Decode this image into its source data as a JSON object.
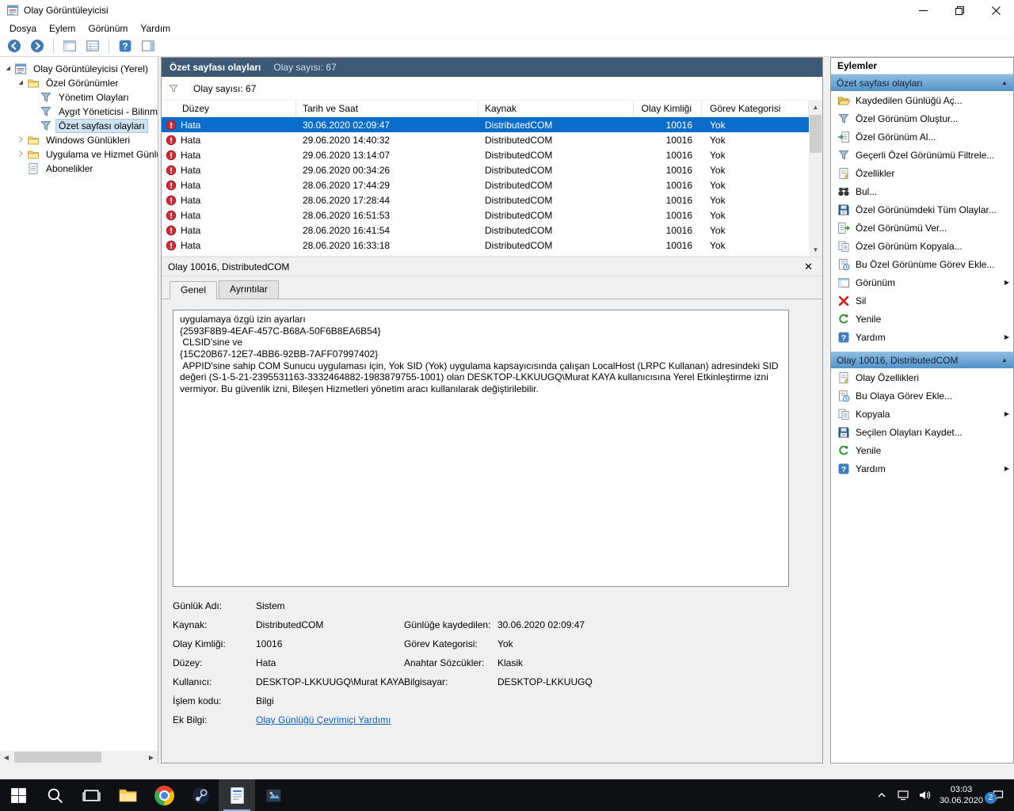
{
  "window": {
    "title": "Olay Görüntüleyicisi",
    "menu_items": [
      "Dosya",
      "Eylem",
      "Görünüm",
      "Yardım"
    ]
  },
  "toolbar": {
    "icons": [
      "back",
      "forward",
      "sep",
      "console-tree",
      "list-view",
      "sep",
      "help",
      "action-pane"
    ]
  },
  "tree": {
    "items": [
      {
        "label": "Olay Görüntüleyicisi (Yerel)",
        "level": 0,
        "icon": "app",
        "expander": "expanded",
        "selected": false
      },
      {
        "label": "Özel Görünümler",
        "level": 1,
        "icon": "folder",
        "expander": "expanded",
        "selected": false
      },
      {
        "label": "Yönetim Olayları",
        "level": 2,
        "icon": "filter",
        "expander": "none",
        "selected": false
      },
      {
        "label": "Aygıt Yöneticisi - Bilinme",
        "level": 2,
        "icon": "filter",
        "expander": "none",
        "selected": false
      },
      {
        "label": "Özet sayfası olayları",
        "level": 2,
        "icon": "filter",
        "expander": "none",
        "selected": true
      },
      {
        "label": "Windows Günlükleri",
        "level": 1,
        "icon": "folder",
        "expander": "collapsed",
        "selected": false
      },
      {
        "label": "Uygulama ve Hizmet Günlük",
        "level": 1,
        "icon": "folder",
        "expander": "collapsed",
        "selected": false
      },
      {
        "label": "Abonelikler",
        "level": 1,
        "icon": "doc",
        "expander": "none",
        "selected": false
      }
    ]
  },
  "main": {
    "header_title": "Özet sayfası olayları",
    "header_count": "Olay sayısı: 67",
    "filter_count": "Olay sayısı: 67",
    "table": {
      "columns": [
        "Düzey",
        "Tarih ve Saat",
        "Kaynak",
        "Olay Kimliği",
        "Görev Kategorisi"
      ],
      "rows": [
        {
          "level": "Hata",
          "datetime": "30.06.2020 02:09:47",
          "source": "DistributedCOM",
          "event_id": "10016",
          "category": "Yok",
          "selected": true
        },
        {
          "level": "Hata",
          "datetime": "29.06.2020 14:40:32",
          "source": "DistributedCOM",
          "event_id": "10016",
          "category": "Yok",
          "selected": false
        },
        {
          "level": "Hata",
          "datetime": "29.06.2020 13:14:07",
          "source": "DistributedCOM",
          "event_id": "10016",
          "category": "Yok",
          "selected": false
        },
        {
          "level": "Hata",
          "datetime": "29.06.2020 00:34:26",
          "source": "DistributedCOM",
          "event_id": "10016",
          "category": "Yok",
          "selected": false
        },
        {
          "level": "Hata",
          "datetime": "28.06.2020 17:44:29",
          "source": "DistributedCOM",
          "event_id": "10016",
          "category": "Yok",
          "selected": false
        },
        {
          "level": "Hata",
          "datetime": "28.06.2020 17:28:44",
          "source": "DistributedCOM",
          "event_id": "10016",
          "category": "Yok",
          "selected": false
        },
        {
          "level": "Hata",
          "datetime": "28.06.2020 16:51:53",
          "source": "DistributedCOM",
          "event_id": "10016",
          "category": "Yok",
          "selected": false
        },
        {
          "level": "Hata",
          "datetime": "28.06.2020 16:41:54",
          "source": "DistributedCOM",
          "event_id": "10016",
          "category": "Yok",
          "selected": false
        },
        {
          "level": "Hata",
          "datetime": "28.06.2020 16:33:18",
          "source": "DistributedCOM",
          "event_id": "10016",
          "category": "Yok",
          "selected": false
        }
      ]
    }
  },
  "detail": {
    "title": "Olay 10016, DistributedCOM",
    "tabs": [
      "Genel",
      "Ayrıntılar"
    ],
    "active_tab": "Genel",
    "description": "uygulamaya özgü izin ayarları\n{2593F8B9-4EAF-457C-B68A-50F6B8EA6B54}\n CLSID'sine ve\n{15C20B67-12E7-4BB6-92BB-7AFF07997402}\n APPID'sine sahip COM Sunucu uygulaması için, Yok SID (Yok) uygulama kapsayıcısında çalışan LocalHost (LRPC Kullanan) adresindeki SID değeri (S-1-5-21-2395531163-3332464882-1983879755-1001) olan DESKTOP-LKKUUGQ\\Murat KAYA kullanıcısına Yerel Etkinleştirme izni vermiyor. Bu güvenlik izni, Bileşen Hizmetleri yönetim aracı kullanılarak değiştirilebilir.",
    "fields": [
      {
        "label": "Günlük Adı:",
        "value": "Sistem",
        "label2": "",
        "value2": "",
        "link": false
      },
      {
        "label": "Kaynak:",
        "value": "DistributedCOM",
        "label2": "Günlüğe kaydedilen:",
        "value2": "30.06.2020 02:09:47",
        "link": false
      },
      {
        "label": "Olay Kimliği:",
        "value": "10016",
        "label2": "Görev Kategorisi:",
        "value2": "Yok",
        "link": false
      },
      {
        "label": "Düzey:",
        "value": "Hata",
        "label2": "Anahtar Sözcükler:",
        "value2": "Klasik",
        "link": false
      },
      {
        "label": "Kullanıcı:",
        "value": "DESKTOP-LKKUUGQ\\Murat KAYA",
        "label2": "Bilgisayar:",
        "value2": "DESKTOP-LKKUUGQ",
        "link": false
      },
      {
        "label": "İşlem kodu:",
        "value": "Bilgi",
        "label2": "",
        "value2": "",
        "link": false
      },
      {
        "label": "Ek Bilgi:",
        "value": "Olay Günlüğü Çevrimiçi Yardımı",
        "label2": "",
        "value2": "",
        "link": true
      }
    ]
  },
  "actions": {
    "title": "Eylemler",
    "groups": [
      {
        "header": "Özet sayfası olayları",
        "items": [
          {
            "label": "Kaydedilen Günlüğü Aç...",
            "icon": "folder-open",
            "submenu": false
          },
          {
            "label": "Özel Görünüm Oluştur...",
            "icon": "filter",
            "submenu": false
          },
          {
            "label": "Özel Görünüm Al...",
            "icon": "import",
            "submenu": false
          },
          {
            "label": "Geçerli Özel Görünümü Filtrele...",
            "icon": "filter",
            "submenu": false
          },
          {
            "label": "Özellikler",
            "icon": "props",
            "submenu": false
          },
          {
            "label": "Bul...",
            "icon": "find",
            "submenu": false
          },
          {
            "label": "Özel Görünümdeki Tüm Olaylar...",
            "icon": "save",
            "submenu": false
          },
          {
            "label": "Özel Görünümü Ver...",
            "icon": "export",
            "submenu": false
          },
          {
            "label": "Özel Görünüm Kopyala...",
            "icon": "copy",
            "submenu": false
          },
          {
            "label": "Bu Özel Görünüme Görev Ekle...",
            "icon": "task",
            "submenu": false
          },
          {
            "label": "Görünüm",
            "icon": "view",
            "submenu": true
          },
          {
            "label": "Sil",
            "icon": "del",
            "submenu": false
          },
          {
            "label": "Yenile",
            "icon": "refresh",
            "submenu": false
          },
          {
            "label": "Yardım",
            "icon": "help",
            "submenu": true
          }
        ]
      },
      {
        "header": "Olay 10016, DistributedCOM",
        "items": [
          {
            "label": "Olay Özellikleri",
            "icon": "props",
            "submenu": false
          },
          {
            "label": "Bu Olaya Görev Ekle...",
            "icon": "task",
            "submenu": false
          },
          {
            "label": "Kopyala",
            "icon": "copy",
            "submenu": true
          },
          {
            "label": "Seçilen Olayları Kaydet...",
            "icon": "save",
            "submenu": false
          },
          {
            "label": "Yenile",
            "icon": "refresh",
            "submenu": false
          },
          {
            "label": "Yardım",
            "icon": "help",
            "submenu": true
          }
        ]
      }
    ]
  },
  "taskbar": {
    "apps": [
      {
        "name": "start",
        "active": false
      },
      {
        "name": "search",
        "active": false
      },
      {
        "name": "task-view",
        "active": false
      },
      {
        "name": "file-explorer",
        "active": false
      },
      {
        "name": "chrome",
        "active": false
      },
      {
        "name": "steam",
        "active": false
      },
      {
        "name": "event-viewer",
        "active": true
      },
      {
        "name": "pinned-app",
        "active": false
      }
    ],
    "clock_time": "03:03",
    "clock_date": "30.06.2020",
    "notification_badge": "2"
  }
}
